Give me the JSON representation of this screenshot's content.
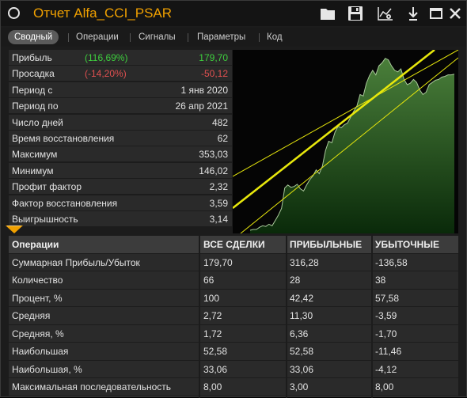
{
  "window": {
    "title": "Отчет Alfa_CCI_PSAR"
  },
  "toolbar": {
    "icons": [
      "folder-icon",
      "save-icon",
      "chart-settings-icon",
      "download-icon",
      "maximize-icon",
      "close-icon"
    ]
  },
  "tabs": [
    {
      "label": "Сводный",
      "active": true
    },
    {
      "label": "Операции",
      "active": false
    },
    {
      "label": "Сигналы",
      "active": false
    },
    {
      "label": "Параметры",
      "active": false
    },
    {
      "label": "Код",
      "active": false
    }
  ],
  "summary": [
    {
      "label": "Прибыль",
      "pct": "(116,69%)",
      "value": "179,70",
      "color": "#3ecf3e"
    },
    {
      "label": "Просадка",
      "pct": "(-14,20%)",
      "value": "-50,12",
      "color": "#e05050"
    },
    {
      "label": "Период с",
      "pct": "",
      "value": "1 янв 2020"
    },
    {
      "label": "Период по",
      "pct": "",
      "value": "26 апр 2021"
    },
    {
      "label": "Число дней",
      "pct": "",
      "value": "482"
    },
    {
      "label": "Время восстановления",
      "pct": "",
      "value": "62"
    },
    {
      "label": "Максимум",
      "pct": "",
      "value": "353,03"
    },
    {
      "label": "Минимум",
      "pct": "",
      "value": "146,02"
    },
    {
      "label": "Профит фактор",
      "pct": "",
      "value": "2,32"
    },
    {
      "label": "Фактор восстановления",
      "pct": "",
      "value": "3,59"
    },
    {
      "label": "Выигрышность",
      "pct": "",
      "value": "3,14"
    }
  ],
  "operations": {
    "headers": [
      "Операции",
      "ВСЕ СДЕЛКИ",
      "ПРИБЫЛЬНЫЕ",
      "УБЫТОЧНЫЕ"
    ],
    "rows": [
      [
        "Суммарная Прибыль/Убыток",
        "179,70",
        "316,28",
        "-136,58"
      ],
      [
        "Количество",
        "66",
        "28",
        "38"
      ],
      [
        "Процент, %",
        "100",
        "42,42",
        "57,58"
      ],
      [
        "Средняя",
        "2,72",
        "11,30",
        "-3,59"
      ],
      [
        "Средняя, %",
        "1,72",
        "6,36",
        "-1,70"
      ],
      [
        "Наибольшая",
        "52,58",
        "52,58",
        "-11,46"
      ],
      [
        "Наибольшая, %",
        "33,06",
        "33,06",
        "-4,12"
      ],
      [
        "Максимальная последовательность",
        "8,00",
        "3,00",
        "8,00"
      ]
    ]
  },
  "chart_data": {
    "type": "area",
    "series": [
      {
        "values": [
          0,
          1,
          1,
          4,
          6,
          5,
          8,
          6,
          13,
          20,
          29,
          56,
          60,
          57,
          58,
          61,
          55,
          52,
          60,
          67,
          72,
          80,
          75,
          85,
          106,
          118,
          116,
          130,
          138,
          136,
          140,
          142,
          150,
          158,
          165,
          180,
          178,
          195,
          205,
          212,
          206,
          218,
          222,
          228,
          226,
          218,
          212,
          210,
          214,
          200,
          193,
          195,
          200,
          196,
          186,
          180,
          183,
          193,
          196,
          199,
          200,
          203,
          204,
          206,
          206,
          207
        ]
      }
    ],
    "ylim": [
      0,
      235
    ],
    "grid": false,
    "colors": {
      "fill_top": "#4a7f3a",
      "fill_bottom": "#0a2a0a",
      "line": "#a9c99a",
      "channel": "#e7e70c"
    }
  }
}
